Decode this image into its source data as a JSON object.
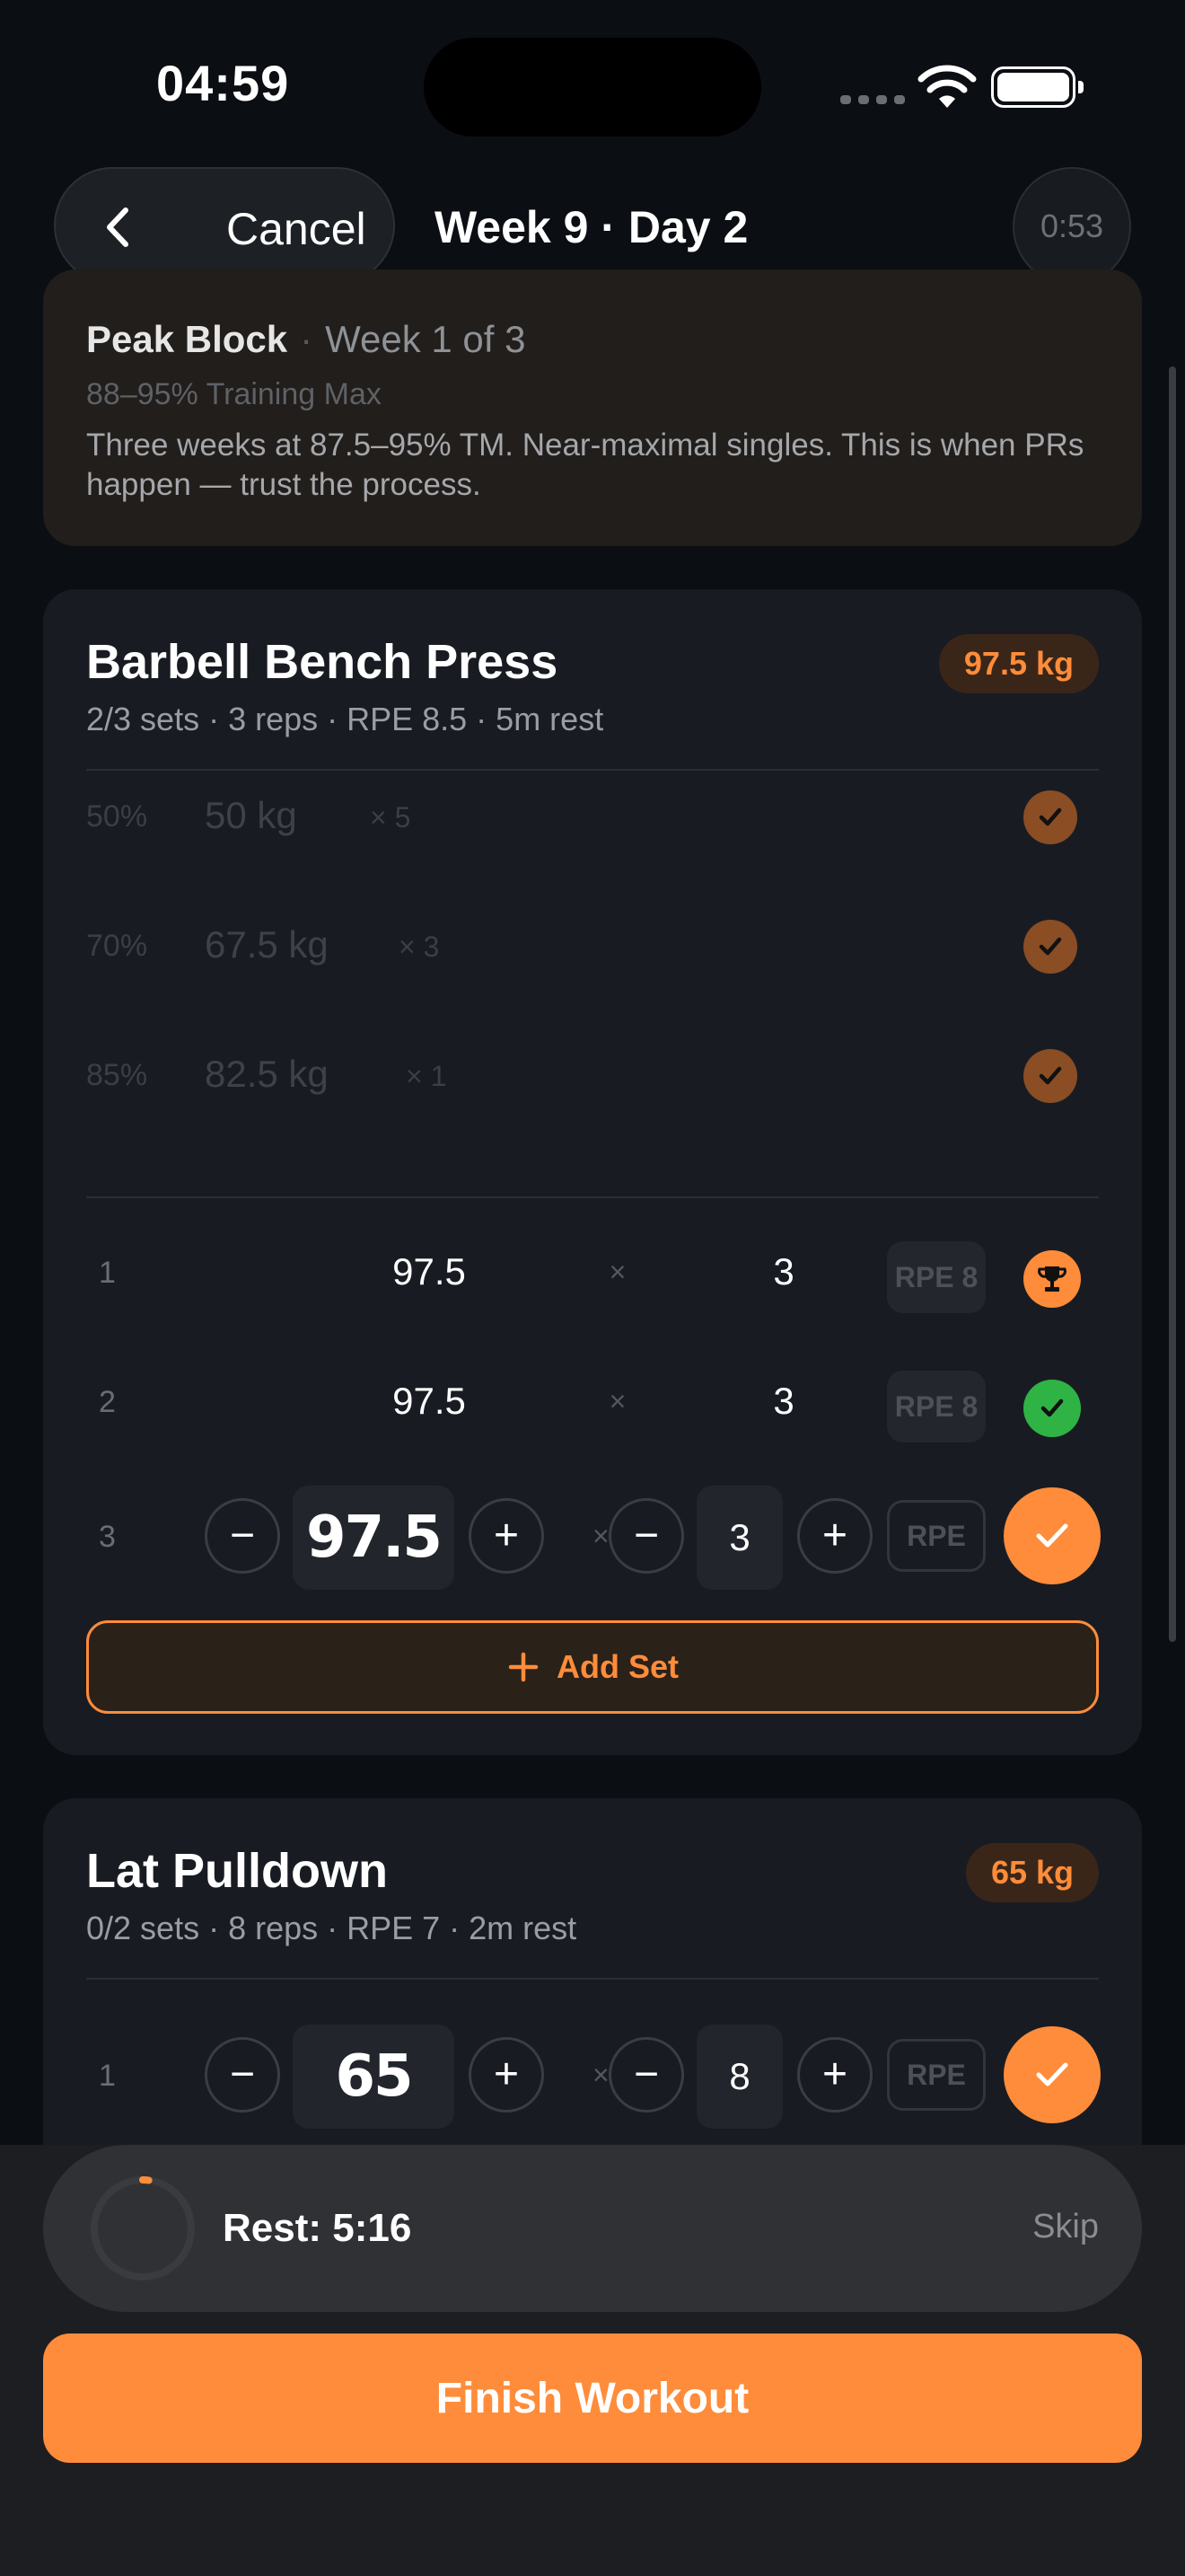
{
  "status_bar": {
    "time": "04:59"
  },
  "nav": {
    "back_label": "Cancel",
    "title": "Week 9 · Day 2",
    "timer": "0:53"
  },
  "phase": {
    "name": "Peak Block",
    "separator": "·",
    "week": "Week 1 of 3",
    "intensity": "88–95% Training Max",
    "description": "Three weeks at 87.5–95% TM. Near-maximal singles. This is when PRs happen — trust the process."
  },
  "exercises": [
    {
      "name": "Barbell Bench Press",
      "meta": "2/3 sets · 3 reps · RPE 8.5 · 5m rest",
      "badge": "97.5 kg",
      "warmups": [
        {
          "pct": "50%",
          "kg": "50 kg",
          "reps": "× 5"
        },
        {
          "pct": "70%",
          "kg": "67.5 kg",
          "reps": "× 3"
        },
        {
          "pct": "85%",
          "kg": "82.5 kg",
          "reps": "× 1"
        }
      ],
      "sets": [
        {
          "index": "1",
          "weight": "97.5",
          "times": "×",
          "reps": "3",
          "rpe": "RPE 8",
          "status": "trophy-icon"
        },
        {
          "index": "2",
          "weight": "97.5",
          "times": "×",
          "reps": "3",
          "rpe": "RPE 8",
          "status": "check-icon"
        }
      ],
      "active_set": {
        "index": "3",
        "minus": "−",
        "plus": "+",
        "weight": "97.5",
        "times": "×",
        "reps": "3",
        "rpe_placeholder": "RPE"
      },
      "add_set_label": "Add Set"
    },
    {
      "name": "Lat Pulldown",
      "meta": "0/2 sets · 8 reps · RPE 7 · 2m rest",
      "badge": "65 kg",
      "active_set": {
        "index": "1",
        "minus": "−",
        "plus": "+",
        "weight": "65",
        "times": "×",
        "reps": "8",
        "rpe_placeholder": "RPE"
      }
    }
  ],
  "rest": {
    "label": "Rest: 5:16",
    "skip": "Skip",
    "progress": 0.02
  },
  "finish_label": "Finish Workout",
  "colors": {
    "accent": "#ff8c3a",
    "success": "#2fb344",
    "background": "#0b0e13",
    "card": "#181c22"
  }
}
